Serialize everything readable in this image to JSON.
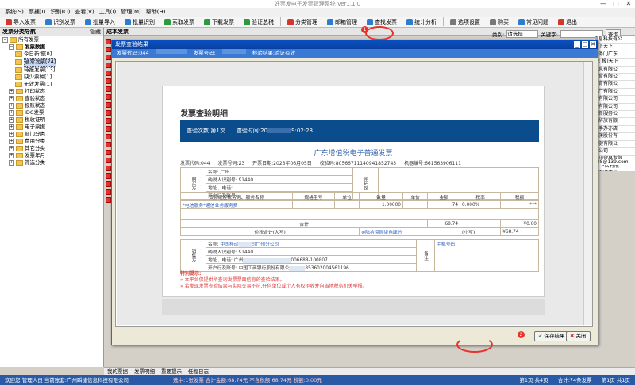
{
  "window": {
    "title": "好票发电子发票管理系统 Ver1.1.0"
  },
  "menu": [
    "系统(S)",
    "票据(I)",
    "识别(O)",
    "查看(V)",
    "工具(I)",
    "管理(M)",
    "帮助(H)"
  ],
  "toolbar": {
    "items": [
      {
        "label": "导入发票",
        "icon": "import-icon",
        "color": "#d9362b"
      },
      {
        "label": "识别发票",
        "icon": "scan-icon",
        "color": "#2e7ccf"
      },
      {
        "label": "批量导入",
        "icon": "batch-import-icon",
        "color": "#2e7ccf"
      },
      {
        "label": "批量识别",
        "icon": "batch-scan-icon",
        "color": "#2e7ccf"
      },
      {
        "label": "索取发票",
        "icon": "request-icon",
        "color": "#2b9a3f"
      },
      {
        "label": "下载发票",
        "icon": "download-icon",
        "color": "#2b9a3f"
      },
      {
        "label": "验证总税",
        "icon": "verify-icon",
        "color": "#2b9a3f"
      },
      {
        "label": "分类管理",
        "icon": "category-icon",
        "color": "#d9362b"
      },
      {
        "label": "邮箱管理",
        "icon": "mail-icon",
        "color": "#2e7ccf"
      },
      {
        "label": "查找发票",
        "icon": "search-icon",
        "color": "#2e7ccf"
      },
      {
        "label": "统计分析",
        "icon": "stats-icon",
        "color": "#2e7ccf"
      },
      {
        "label": "选项设置",
        "icon": "settings-icon",
        "color": "#777777"
      },
      {
        "label": "购买",
        "icon": "cart-icon",
        "color": "#777777"
      },
      {
        "label": "常见问题",
        "icon": "help-icon",
        "color": "#2e7ccf"
      },
      {
        "label": "退出",
        "icon": "exit-icon",
        "color": "#d9362b"
      }
    ]
  },
  "left": {
    "header": "发票分类导航",
    "toggle": "隐藏",
    "tree": [
      {
        "label": "所有发票",
        "level": 0,
        "expanded": true
      },
      {
        "label": "发票数据",
        "level": 1,
        "expanded": true,
        "bold": true
      },
      {
        "label": "今日新增[0]",
        "level": 2
      },
      {
        "label": "通常发票[74]",
        "level": 2,
        "selected": true
      },
      {
        "label": "待报发票[13]",
        "level": 2
      },
      {
        "label": "缺少票种[1]",
        "level": 2
      },
      {
        "label": "无效发票[1]",
        "level": 2
      },
      {
        "label": "打印状态",
        "level": 1
      },
      {
        "label": "查验状态",
        "level": 1
      },
      {
        "label": "报账状态",
        "level": 1
      },
      {
        "label": "IDC发票",
        "level": 1
      },
      {
        "label": "税收证明",
        "level": 1
      },
      {
        "label": "电子票据",
        "level": 1
      },
      {
        "label": "部门分类",
        "level": 1
      },
      {
        "label": "费用分类",
        "level": 1
      },
      {
        "label": "其它分类",
        "level": 1
      },
      {
        "label": "发票年月",
        "level": 1
      },
      {
        "label": "筛选分类",
        "level": 1
      }
    ]
  },
  "main": {
    "header": "成本发票",
    "filter": {
      "label": "类别:",
      "value": "请选择",
      "keyword_label": "关键字:",
      "search": "查询"
    },
    "right_column": [
      "信息科技有公",
      "天下天下",
      "服务门广东",
      "[已 报]天下",
      "信息有限公",
      "安食有限公",
      "体育有限公",
      "三厂有限公",
      "计有限公司",
      "料有限公司",
      "报新服务公",
      "下辞旅有限",
      "二手办亦店",
      "肝旗股份有",
      "保健有限公",
      "下公司",
      "广州贸易有限",
      "天 下店有限",
      "广东肝店公",
      "酒店有限公",
      "天下公司"
    ],
    "right_email": "008@139.com"
  },
  "dialog": {
    "title": "发票查验结果",
    "info": {
      "code_label": "发票代码:044",
      "number_label": "发票号码:",
      "result_label": "检验结果:验证有效"
    },
    "paper": {
      "title": "发票查验明细",
      "check_count": "查验次数:第1次",
      "check_time": "查验时间:20",
      "check_time_tail": "9:02:23",
      "invoice_title": "广东增值税电子普通发票",
      "meta": {
        "code": "发票代码:044",
        "number": "发票号码:23",
        "date": "开票日期:2023年06月05日",
        "check": "校验码:80566711140941852743",
        "machine": "机器编号:661563906111"
      },
      "buyer": {
        "side": "购买方",
        "name": "名称:",
        "name_val": "广州",
        "tax": "纳税人识别号:",
        "tax_val": "91440",
        "addr": "地址、电话:",
        "bank": "开户行及账号:",
        "pwd": "密码区"
      },
      "items_header": [
        "货物或应税劳务、服务名称",
        "规格型号",
        "单位",
        "数量",
        "单价",
        "金额",
        "税率",
        "税额"
      ],
      "item_row": {
        "name": "*电信服务*通信业务服务费",
        "qty": "1.00000",
        "amount": "74",
        "rate": "0.000%",
        "tax": "***"
      },
      "sum_row": {
        "label": "合计",
        "amount": "68.74",
        "tax": "¥0.00"
      },
      "total_row": {
        "label": "价税合计(大写)",
        "upper": "⊗陆拾捌圆柒角肆分",
        "lower_label": "(小写)",
        "lower": "¥68.74"
      },
      "seller": {
        "side": "销售方",
        "name": "名称:",
        "name_val": "中国移动",
        "name_tail": "司广州分公司",
        "tax": "纳税人识别号:",
        "tax_val": "91440",
        "addr": "地址、电话:",
        "addr_val": "广州",
        "addr_tail": "006688-100807",
        "bank": "开户行及账号:",
        "bank_val": "中国工商银行股份有限公",
        "bank_tail": "853602004561196",
        "note": "备注",
        "phone": "手机号码:"
      },
      "notes_title": "特别提示:",
      "notes": [
        "本平台仅提供所查询发票票面信息的查验结果。",
        "若发现发票查验结果与实际交易不符,任何单位或个人有权拒收并向当地税务机关举报。"
      ]
    },
    "buttons": {
      "save": "保存结果",
      "close": "关闭"
    }
  },
  "bottom_tabs": [
    "我的票据",
    "发票明细",
    "重要提示",
    "任程日志"
  ],
  "status": {
    "welcome": "欢迎您:管理人员 当前账套:广州瞬捷信息科技有限公司",
    "selection": "选中:1张发票 合计金额:68.74元 不含税额:68.74元 税额:0.00元",
    "pages1": "第1页 共4页",
    "pages2": "合计:74条发票",
    "pages3": "第1页 共1页"
  }
}
